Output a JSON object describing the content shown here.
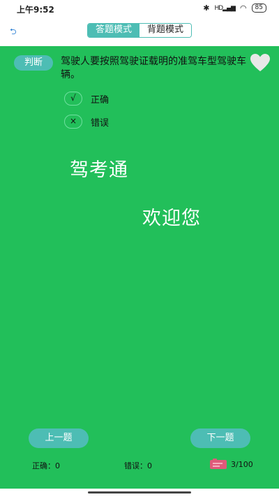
{
  "status_bar": {
    "time": "上午9:52",
    "bluetooth_icon": "bluetooth-icon",
    "signal_text": "HD",
    "battery": "85"
  },
  "header": {
    "back_icon": "back-icon",
    "modes": [
      "答题模式",
      "背题模式"
    ],
    "active_mode_index": 0
  },
  "question": {
    "type": "判断",
    "text": "驾驶人要按照驾驶证载明的准驾车型驾驶车辆。",
    "favorite_icon": "heart-icon",
    "options": [
      {
        "mark": "√",
        "label": "正确"
      },
      {
        "mark": "×",
        "label": "错误"
      }
    ]
  },
  "splash": {
    "title": "驾考通",
    "welcome": "欢迎您"
  },
  "navigation": {
    "prev": "上一题",
    "next": "下一题"
  },
  "stats": {
    "correct": "正确：0",
    "wrong": "错误：0",
    "progress": "3/100",
    "card_icon": "answer-card-icon"
  },
  "colors": {
    "main_bg": "#22bf5a",
    "accent": "#4dbdb4",
    "heart": "#e8e8e8",
    "card_icon": "#e05a7a"
  }
}
